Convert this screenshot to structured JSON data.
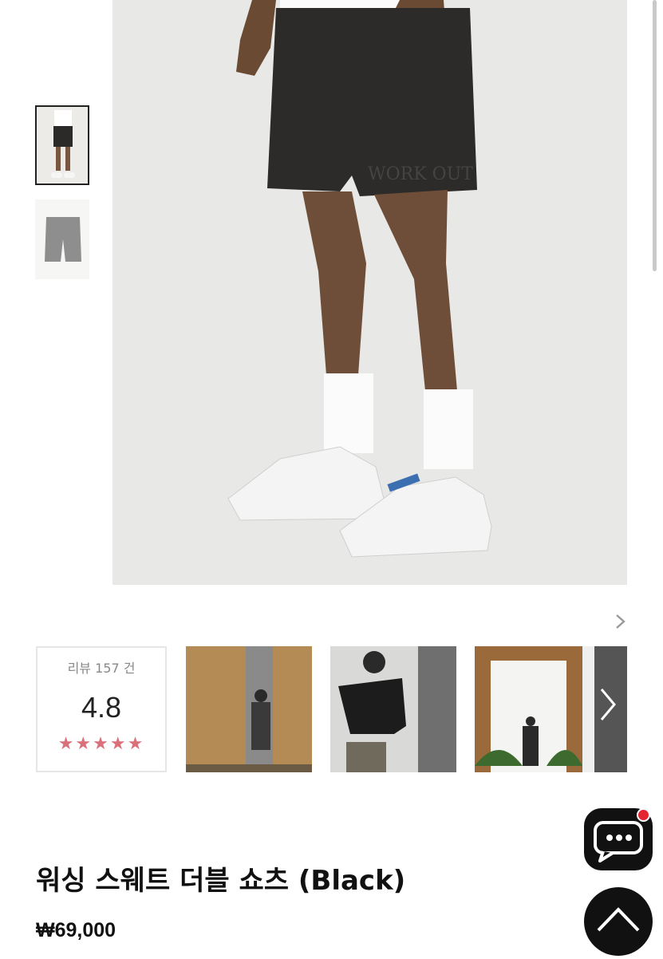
{
  "gallery": {
    "thumbnails": [
      {
        "alt": "model-wearing-shorts",
        "active": true
      },
      {
        "alt": "shorts-flat-gray",
        "active": false
      }
    ],
    "next_icon": "chevron-right-icon"
  },
  "reviews": {
    "label": "리뷰 157 건",
    "score": "4.8",
    "stars": "★★★★★",
    "star_color": "#d9707a"
  },
  "product": {
    "title": "워싱 스웨트 더블 쇼츠 (Black)",
    "price": "₩69,000"
  },
  "floating": {
    "chat_icon": "chat-bubble-icon",
    "top_icon": "arrow-up-icon",
    "badge_color": "#e3262f"
  }
}
